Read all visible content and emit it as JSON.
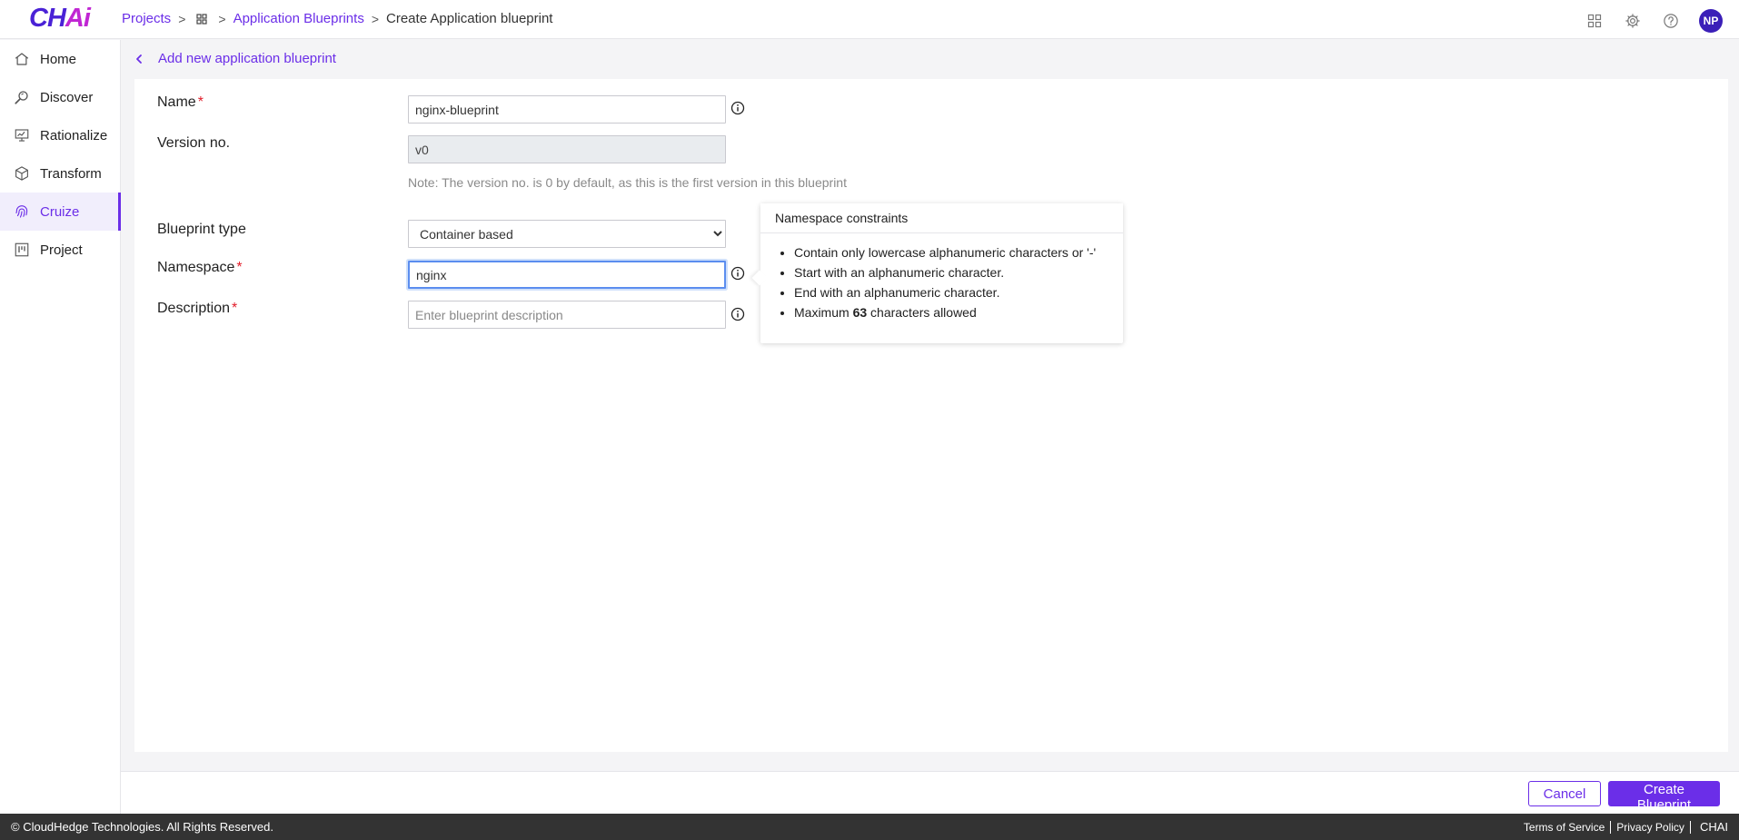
{
  "app": {
    "logo_main": "CH",
    "logo_accent": "Ai"
  },
  "breadcrumb": {
    "projects": "Projects",
    "blueprints": "Application Blueprints",
    "current": "Create Application blueprint",
    "separator": ">"
  },
  "header": {
    "avatar_initials": "NP"
  },
  "sidebar": {
    "items": [
      {
        "label": "Home",
        "icon": "home-icon"
      },
      {
        "label": "Discover",
        "icon": "discover-icon"
      },
      {
        "label": "Rationalize",
        "icon": "rationalize-icon"
      },
      {
        "label": "Transform",
        "icon": "cube-icon"
      },
      {
        "label": "Cruize",
        "icon": "fingerprint-icon",
        "active": true
      },
      {
        "label": "Project",
        "icon": "board-icon"
      }
    ]
  },
  "page": {
    "title": "Add new application blueprint"
  },
  "form": {
    "name": {
      "label": "Name",
      "value": "nginx-blueprint"
    },
    "version": {
      "label": "Version no.",
      "value": "v0",
      "note": "Note: The version no. is 0 by default, as this is the first version in this blueprint"
    },
    "blueprint_type": {
      "label": "Blueprint type",
      "selected": "Container based"
    },
    "namespace": {
      "label": "Namespace",
      "value": "nginx"
    },
    "description": {
      "label": "Description",
      "placeholder": "Enter blueprint description"
    },
    "required_mark": "*"
  },
  "tooltip": {
    "title": "Namespace constraints",
    "items": [
      "Contain only lowercase alphanumeric characters or '-'",
      "Start with an alphanumeric character.",
      "End with an alphanumeric character."
    ],
    "max_prefix": "Maximum",
    "max_value": "63",
    "max_suffix": "characters allowed"
  },
  "actions": {
    "cancel": "Cancel",
    "create": "Create Blueprint"
  },
  "footer": {
    "copyright": "© CloudHedge Technologies. All Rights Reserved.",
    "terms": "Terms of Service",
    "privacy": "Privacy Policy",
    "brand": "CHAI"
  },
  "colors": {
    "accent": "#6b2ee8",
    "required": "#e11d2a",
    "footer_bg": "#333333"
  }
}
